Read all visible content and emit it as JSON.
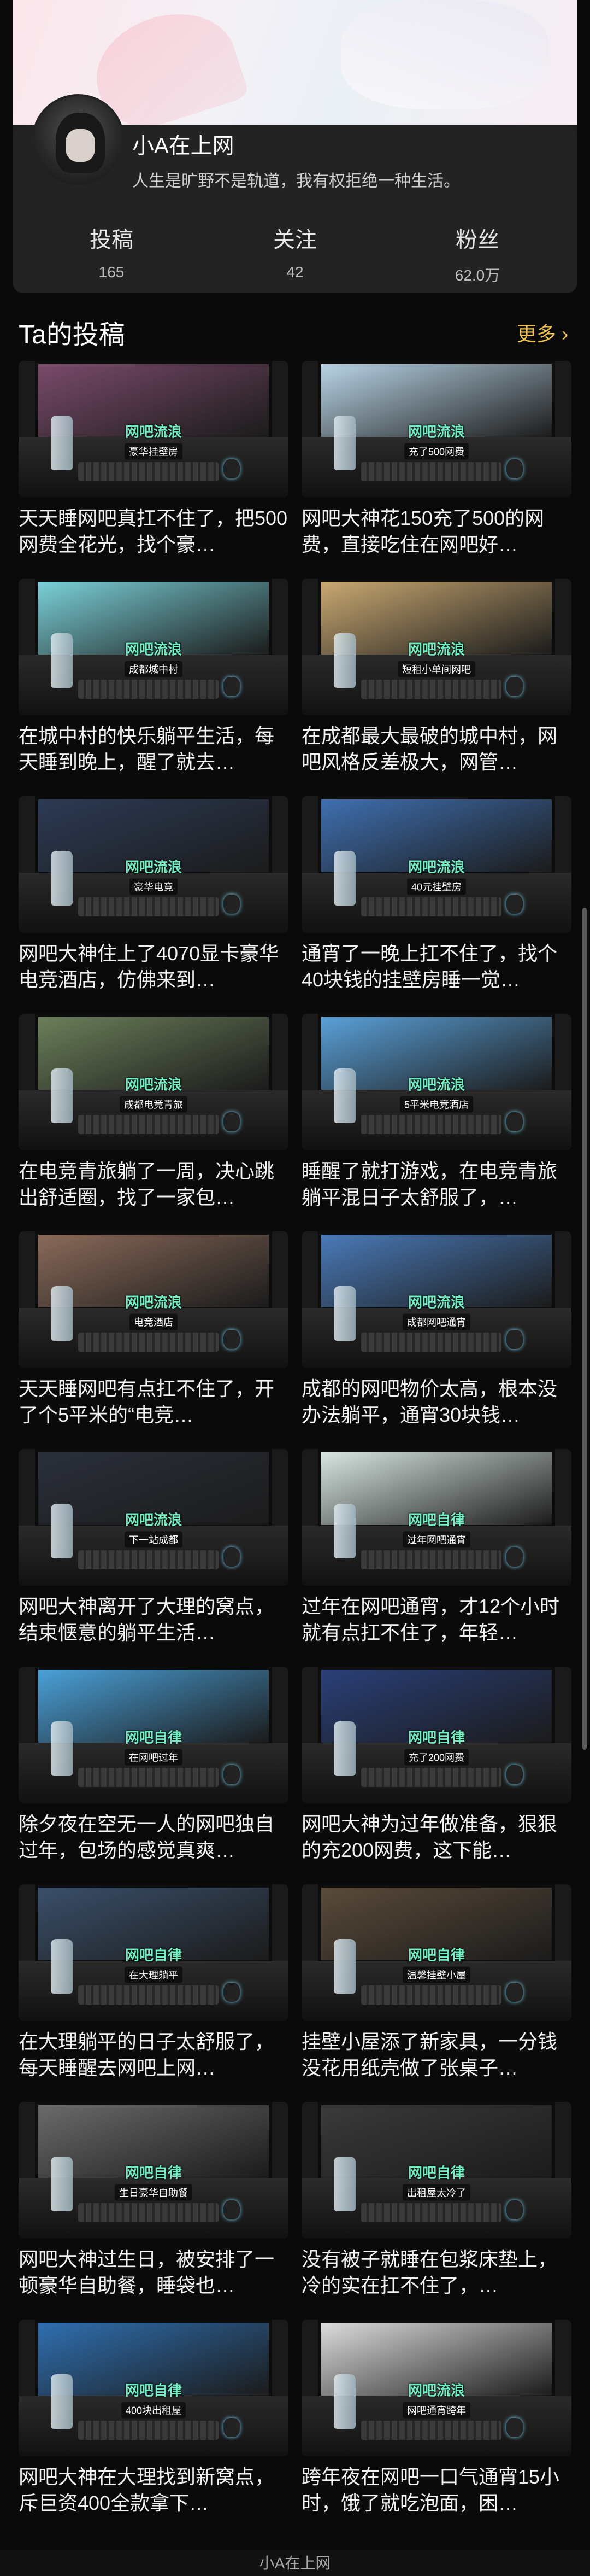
{
  "profile": {
    "nickname": "小A在上网",
    "bio": "人生是旷野不是轨道，我有权拒绝一种生活。",
    "stats": [
      {
        "label": "投稿",
        "value": "165"
      },
      {
        "label": "关注",
        "value": "42"
      },
      {
        "label": "粉丝",
        "value": "62.0万"
      }
    ]
  },
  "section": {
    "title": "Ta的投稿",
    "more": "更多 ›"
  },
  "posts": [
    {
      "tag": "网吧流浪",
      "sub": "豪华挂壁房",
      "caption": "天天睡网吧真扛不住了，把500网费全花光，找个豪…",
      "monitor": "#7a4a6a"
    },
    {
      "tag": "网吧流浪",
      "sub": "充了500网费",
      "caption": "网吧大神花150充了500的网费，直接吃住在网吧好…",
      "monitor": "#b9d4e6"
    },
    {
      "tag": "网吧流浪",
      "sub": "成都城中村",
      "caption": "在城中村的快乐躺平生活，每天睡到晚上，醒了就去…",
      "monitor": "#7ad0d8"
    },
    {
      "tag": "网吧流浪",
      "sub": "短租小单间网吧",
      "caption": "在成都最大最破的城中村，网吧风格反差极大，网管…",
      "monitor": "#c9a872"
    },
    {
      "tag": "网吧流浪",
      "sub": "豪华电竞",
      "caption": "网吧大神住上了4070显卡豪华电竞酒店，仿佛来到…",
      "monitor": "#2d3a55"
    },
    {
      "tag": "网吧流浪",
      "sub": "40元挂壁房",
      "caption": "通宵了一晚上扛不住了，找个40块钱的挂壁房睡一觉…",
      "monitor": "#3f6fb0"
    },
    {
      "tag": "网吧流浪",
      "sub": "成都电竞青旅",
      "caption": "在电竞青旅躺了一周，决心跳出舒适圈，找了一家包…",
      "monitor": "#6b7f5a"
    },
    {
      "tag": "网吧流浪",
      "sub": "5平米电竞酒店",
      "caption": "睡醒了就打游戏，在电竞青旅躺平混日子太舒服了，…",
      "monitor": "#5aa0d8"
    },
    {
      "tag": "网吧流浪",
      "sub": "电竞酒店",
      "caption": "天天睡网吧有点扛不住了，开了个5平米的“电竞…",
      "monitor": "#8a6a5a"
    },
    {
      "tag": "网吧流浪",
      "sub": "成都网吧通宵",
      "caption": "成都的网吧物价太高，根本没办法躺平，通宵30块钱…",
      "monitor": "#4a7ab8"
    },
    {
      "tag": "网吧流浪",
      "sub": "下一站成都",
      "caption": "网吧大神离开了大理的窝点，结束惬意的躺平生活…",
      "monitor": "#2a2f3a"
    },
    {
      "tag": "网吧自律",
      "sub": "过年网吧通宵",
      "caption": "过年在网吧通宵，才12个小时就有点扛不住了，年轻…",
      "monitor": "#d8e6e0"
    },
    {
      "tag": "网吧自律",
      "sub": "在网吧过年",
      "caption": "除夕夜在空无一人的网吧独自过年，包场的感觉真爽…",
      "monitor": "#4aa0d8"
    },
    {
      "tag": "网吧自律",
      "sub": "充了200网费",
      "caption": "网吧大神为过年做准备，狠狠的充200网费，这下能…",
      "monitor": "#2a3f78"
    },
    {
      "tag": "网吧自律",
      "sub": "在大理躺平",
      "caption": "在大理躺平的日子太舒服了，每天睡醒去网吧上网…",
      "monitor": "#3a4f6a"
    },
    {
      "tag": "网吧自律",
      "sub": "温馨挂壁小屋",
      "caption": "挂壁小屋添了新家具，一分钱没花用纸壳做了张桌子…",
      "monitor": "#5a4a3a"
    },
    {
      "tag": "网吧自律",
      "sub": "生日豪华自助餐",
      "caption": "网吧大神过生日，被安排了一顿豪华自助餐，睡袋也…",
      "monitor": "#6a6a6a"
    },
    {
      "tag": "网吧自律",
      "sub": "出租屋太冷了",
      "caption": "没有被子就睡在包浆床垫上，冷的实在扛不住了，…",
      "monitor": "#3a3a3a"
    },
    {
      "tag": "网吧自律",
      "sub": "400块出租屋",
      "caption": "网吧大神在大理找到新窝点，斥巨资400全款拿下…",
      "monitor": "#2f6fb0"
    },
    {
      "tag": "网吧流浪",
      "sub": "网吧通宵跨年",
      "caption": "跨年夜在网吧一口气通宵15小时，饿了就吃泡面，困…",
      "monitor": "#dcdcdc"
    }
  ],
  "footer": {
    "text": "小A在上网"
  },
  "colors": {
    "accent": "#f0c44a",
    "tag": "#6ef0c4"
  }
}
